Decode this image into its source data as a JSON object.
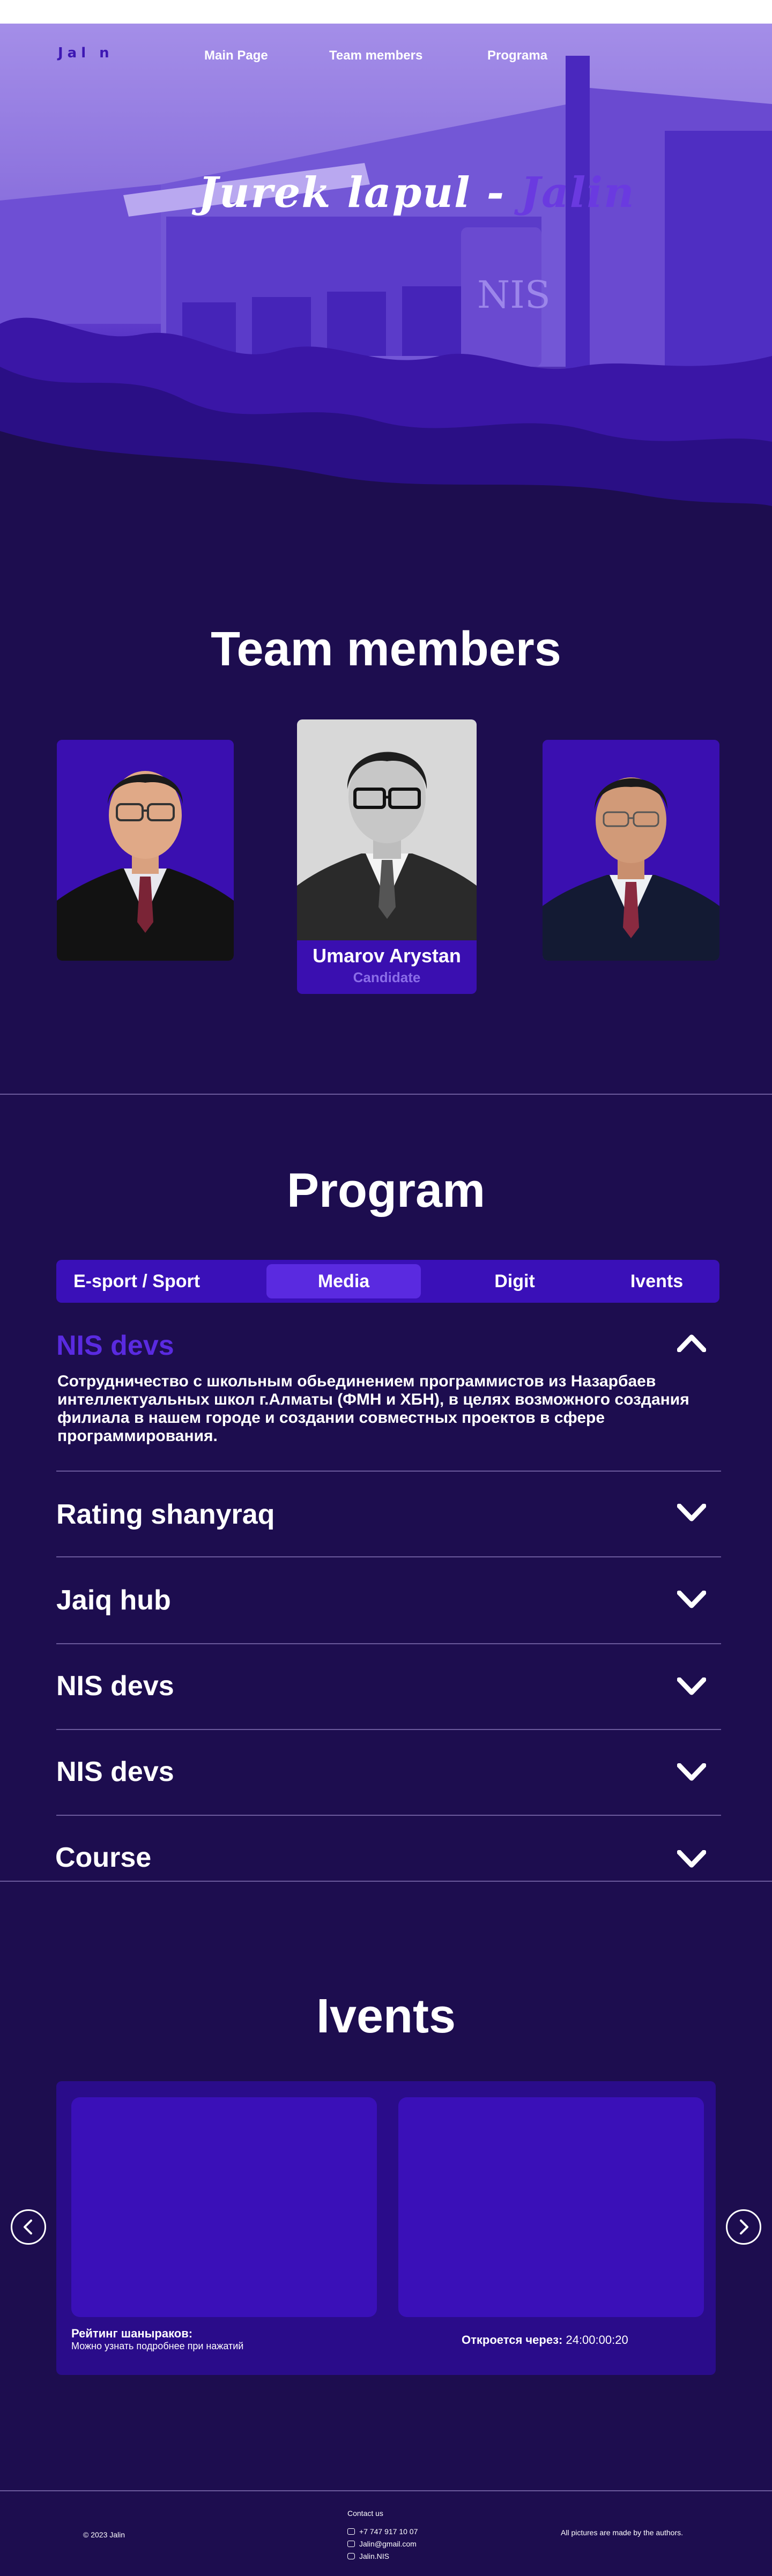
{
  "nav": {
    "logo": "Jal n",
    "links": [
      "Main Page",
      "Team members",
      "Programa"
    ]
  },
  "hero": {
    "title_main": "Jurek lapul -",
    "title_accent": "Jalin",
    "building_sign": "NIS"
  },
  "team": {
    "title": "Team members",
    "featured": {
      "name": "Umarov Arystan",
      "role": "Candidate"
    }
  },
  "program": {
    "title": "Program",
    "tabs": [
      "E-sport / Sport",
      "Media",
      "Digit",
      "Ivents"
    ],
    "active_tab": "Media",
    "items": [
      {
        "title": "NIS devs",
        "open": true,
        "body": "Сотрудничество с школьным обьединением программистов из Назарбаев интеллектуальных школ г.Алматы (ФМН и ХБН), в целях возможного создания филиала в нашем городе и создании совместных проектов в сфере программирования."
      },
      {
        "title": "Rating shanyraq",
        "open": false
      },
      {
        "title": "Jaiq hub",
        "open": false
      },
      {
        "title": "NIS devs",
        "open": false
      },
      {
        "title": "NIS devs",
        "open": false
      },
      {
        "title": "Course",
        "open": false
      }
    ]
  },
  "events": {
    "title": "Ivents",
    "rating_title": "Рейтинг шаныраков:",
    "rating_sub": "Можно узнать подробнее при нажатий",
    "opens_label": "Откроется через:",
    "opens_time": "24:00:00:20"
  },
  "footer": {
    "copyright": "© 2023 Jalin",
    "contact_title": "Contact us",
    "phone": "+7 747 917 10 07",
    "email": "Jalin@gmail.com",
    "instagram": "Jalin.NIS",
    "rights": "All pictures are made by the authors."
  },
  "colors": {
    "accent": "#5a2ae0",
    "background": "#1d0d4f",
    "panel": "#3a10b8"
  },
  "icons": [
    "chevron-up-icon",
    "chevron-down-icon",
    "arrow-left-icon",
    "arrow-right-icon",
    "phone-icon",
    "mail-icon",
    "instagram-icon"
  ]
}
